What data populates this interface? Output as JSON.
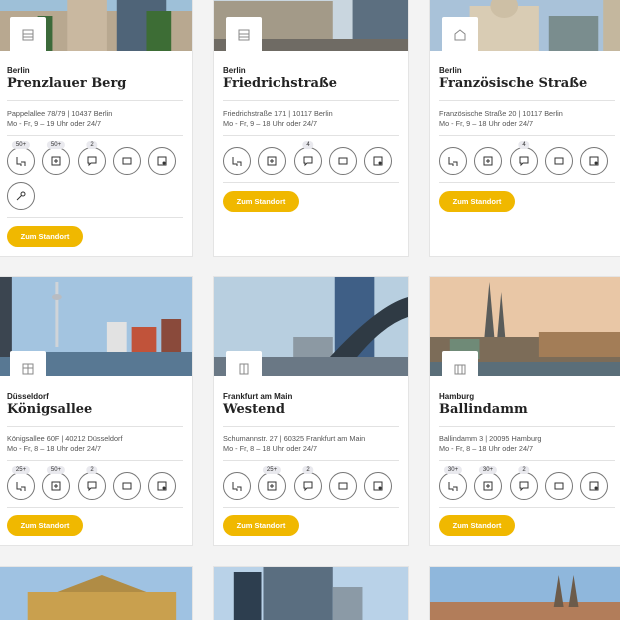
{
  "cards": [
    {
      "city": "Berlin",
      "name": "Prenzlauer Berg",
      "address": "Pappelallee 78/79 | 10437 Berlin",
      "hours": "Mo - Fr, 9 – 19 Uhr oder 24/7",
      "counts": [
        "50+",
        "50+",
        "2",
        "",
        ""
      ],
      "button": "Zum Standort"
    },
    {
      "city": "Berlin",
      "name": "Friedrichstraße",
      "address": "Friedrichstraße 171 | 10117 Berlin",
      "hours": "Mo - Fr, 9 – 18 Uhr oder 24/7",
      "counts": [
        "",
        "",
        "4",
        "",
        ""
      ],
      "button": "Zum Standort"
    },
    {
      "city": "Berlin",
      "name": "Französische Straße",
      "address": "Französische Straße 20 | 10117 Berlin",
      "hours": "Mo - Fr, 9 – 18 Uhr oder 24/7",
      "counts": [
        "",
        "",
        "4",
        "",
        ""
      ],
      "button": "Zum Standort"
    },
    {
      "city": "Düsseldorf",
      "name": "Königsallee",
      "address": "Königsallee 60F | 40212 Düsseldorf",
      "hours": "Mo - Fr, 8 – 18 Uhr oder 24/7",
      "counts": [
        "25+",
        "50+",
        "2",
        "",
        ""
      ],
      "button": "Zum Standort"
    },
    {
      "city": "Frankfurt am Main",
      "name": "Westend",
      "address": "Schumannstr. 27 | 60325 Frankfurt am Main",
      "hours": "Mo - Fr, 8 – 18 Uhr oder 24/7",
      "counts": [
        "",
        "25+",
        "2",
        "",
        ""
      ],
      "button": "Zum Standort"
    },
    {
      "city": "Hamburg",
      "name": "Ballindamm",
      "address": "Ballindamm 3 | 20095 Hamburg",
      "hours": "Mo - Fr, 8 – 18 Uhr oder 24/7",
      "counts": [
        "30+",
        "30+",
        "2",
        "",
        ""
      ],
      "button": "Zum Standort"
    }
  ],
  "icons": {
    "badge": "building-icon",
    "services": [
      "desk-icon",
      "people-icon",
      "chat-icon",
      "screen-icon",
      "whiteboard-icon"
    ],
    "extra": "key-icon"
  },
  "colors": {
    "accent": "#f0b800"
  }
}
